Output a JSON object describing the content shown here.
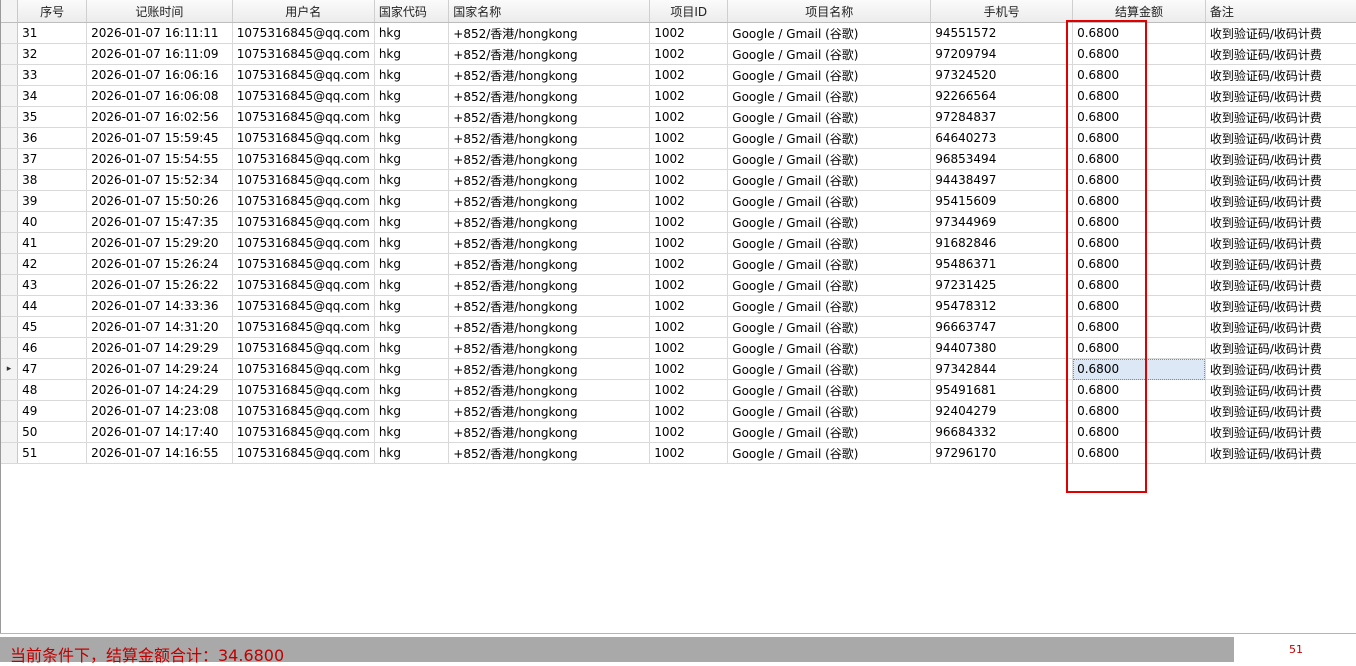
{
  "grid": {
    "columns": [
      "序号",
      "记账时间",
      "用户名",
      "国家代码",
      "国家名称",
      "项目ID",
      "项目名称",
      "手机号",
      "结算金额",
      "备注"
    ],
    "rows": [
      [
        "31",
        "2026-01-07 16:11:11",
        "1075316845@qq.com",
        "hkg",
        "+852/香港/hongkong",
        "1002",
        "Google / Gmail (谷歌)",
        "94551572",
        "0.6800",
        "收到验证码/收码计费"
      ],
      [
        "32",
        "2026-01-07 16:11:09",
        "1075316845@qq.com",
        "hkg",
        "+852/香港/hongkong",
        "1002",
        "Google / Gmail (谷歌)",
        "97209794",
        "0.6800",
        "收到验证码/收码计费"
      ],
      [
        "33",
        "2026-01-07 16:06:16",
        "1075316845@qq.com",
        "hkg",
        "+852/香港/hongkong",
        "1002",
        "Google / Gmail (谷歌)",
        "97324520",
        "0.6800",
        "收到验证码/收码计费"
      ],
      [
        "34",
        "2026-01-07 16:06:08",
        "1075316845@qq.com",
        "hkg",
        "+852/香港/hongkong",
        "1002",
        "Google / Gmail (谷歌)",
        "92266564",
        "0.6800",
        "收到验证码/收码计费"
      ],
      [
        "35",
        "2026-01-07 16:02:56",
        "1075316845@qq.com",
        "hkg",
        "+852/香港/hongkong",
        "1002",
        "Google / Gmail (谷歌)",
        "97284837",
        "0.6800",
        "收到验证码/收码计费"
      ],
      [
        "36",
        "2026-01-07 15:59:45",
        "1075316845@qq.com",
        "hkg",
        "+852/香港/hongkong",
        "1002",
        "Google / Gmail (谷歌)",
        "64640273",
        "0.6800",
        "收到验证码/收码计费"
      ],
      [
        "37",
        "2026-01-07 15:54:55",
        "1075316845@qq.com",
        "hkg",
        "+852/香港/hongkong",
        "1002",
        "Google / Gmail (谷歌)",
        "96853494",
        "0.6800",
        "收到验证码/收码计费"
      ],
      [
        "38",
        "2026-01-07 15:52:34",
        "1075316845@qq.com",
        "hkg",
        "+852/香港/hongkong",
        "1002",
        "Google / Gmail (谷歌)",
        "94438497",
        "0.6800",
        "收到验证码/收码计费"
      ],
      [
        "39",
        "2026-01-07 15:50:26",
        "1075316845@qq.com",
        "hkg",
        "+852/香港/hongkong",
        "1002",
        "Google / Gmail (谷歌)",
        "95415609",
        "0.6800",
        "收到验证码/收码计费"
      ],
      [
        "40",
        "2026-01-07 15:47:35",
        "1075316845@qq.com",
        "hkg",
        "+852/香港/hongkong",
        "1002",
        "Google / Gmail (谷歌)",
        "97344969",
        "0.6800",
        "收到验证码/收码计费"
      ],
      [
        "41",
        "2026-01-07 15:29:20",
        "1075316845@qq.com",
        "hkg",
        "+852/香港/hongkong",
        "1002",
        "Google / Gmail (谷歌)",
        "91682846",
        "0.6800",
        "收到验证码/收码计费"
      ],
      [
        "42",
        "2026-01-07 15:26:24",
        "1075316845@qq.com",
        "hkg",
        "+852/香港/hongkong",
        "1002",
        "Google / Gmail (谷歌)",
        "95486371",
        "0.6800",
        "收到验证码/收码计费"
      ],
      [
        "43",
        "2026-01-07 15:26:22",
        "1075316845@qq.com",
        "hkg",
        "+852/香港/hongkong",
        "1002",
        "Google / Gmail (谷歌)",
        "97231425",
        "0.6800",
        "收到验证码/收码计费"
      ],
      [
        "44",
        "2026-01-07 14:33:36",
        "1075316845@qq.com",
        "hkg",
        "+852/香港/hongkong",
        "1002",
        "Google / Gmail (谷歌)",
        "95478312",
        "0.6800",
        "收到验证码/收码计费"
      ],
      [
        "45",
        "2026-01-07 14:31:20",
        "1075316845@qq.com",
        "hkg",
        "+852/香港/hongkong",
        "1002",
        "Google / Gmail (谷歌)",
        "96663747",
        "0.6800",
        "收到验证码/收码计费"
      ],
      [
        "46",
        "2026-01-07 14:29:29",
        "1075316845@qq.com",
        "hkg",
        "+852/香港/hongkong",
        "1002",
        "Google / Gmail (谷歌)",
        "94407380",
        "0.6800",
        "收到验证码/收码计费"
      ],
      [
        "47",
        "2026-01-07 14:29:24",
        "1075316845@qq.com",
        "hkg",
        "+852/香港/hongkong",
        "1002",
        "Google / Gmail (谷歌)",
        "97342844",
        "0.6800",
        "收到验证码/收码计费"
      ],
      [
        "48",
        "2026-01-07 14:24:29",
        "1075316845@qq.com",
        "hkg",
        "+852/香港/hongkong",
        "1002",
        "Google / Gmail (谷歌)",
        "95491681",
        "0.6800",
        "收到验证码/收码计费"
      ],
      [
        "49",
        "2026-01-07 14:23:08",
        "1075316845@qq.com",
        "hkg",
        "+852/香港/hongkong",
        "1002",
        "Google / Gmail (谷歌)",
        "92404279",
        "0.6800",
        "收到验证码/收码计费"
      ],
      [
        "50",
        "2026-01-07 14:17:40",
        "1075316845@qq.com",
        "hkg",
        "+852/香港/hongkong",
        "1002",
        "Google / Gmail (谷歌)",
        "96684332",
        "0.6800",
        "收到验证码/收码计费"
      ],
      [
        "51",
        "2026-01-07 14:16:55",
        "1075316845@qq.com",
        "hkg",
        "+852/香港/hongkong",
        "1002",
        "Google / Gmail (谷歌)",
        "97296170",
        "0.6800",
        "收到验证码/收码计费"
      ]
    ],
    "selected_row": 16,
    "row_pointer_icon": "row-pointer-icon"
  },
  "footer": {
    "summary": "当前条件下，结算金额合计：34.6800",
    "count": "51"
  },
  "colors": {
    "highlight_box": "#e00000",
    "footer_text": "#c00000",
    "footer_bar": "#a9a9a9",
    "selected_cell": "#dde8f7"
  }
}
